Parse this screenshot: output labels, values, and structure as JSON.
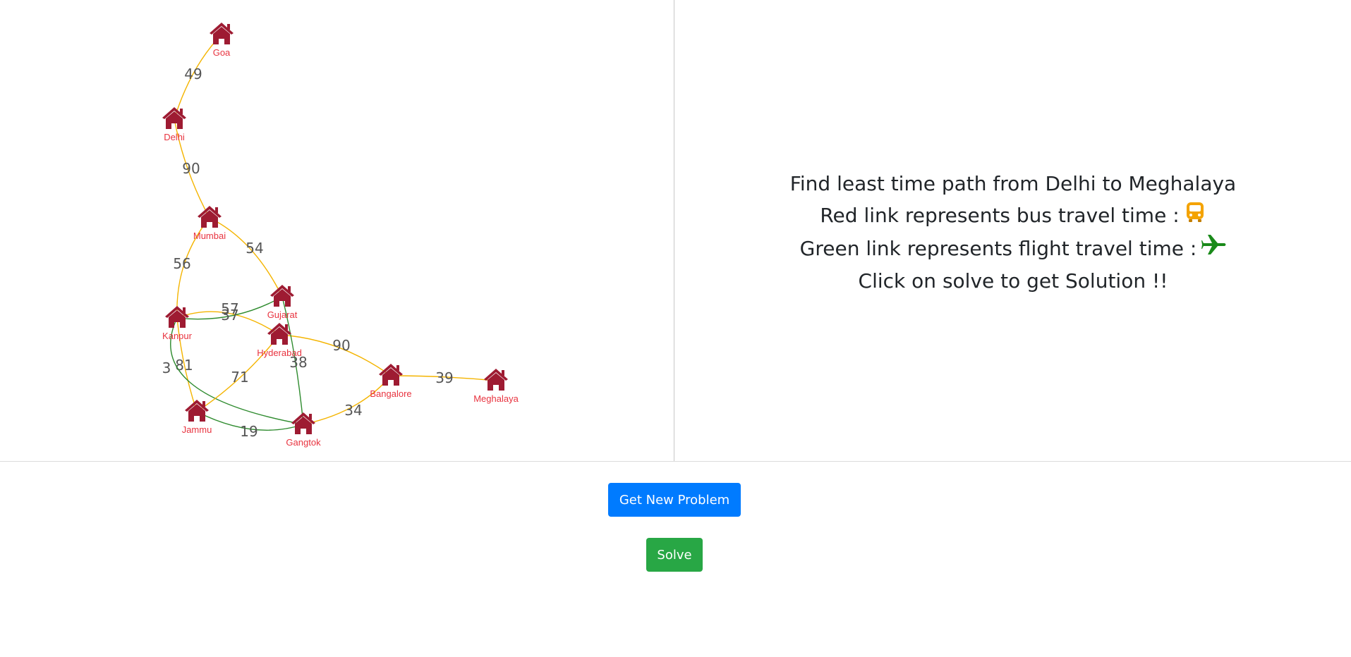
{
  "graph": {
    "colors": {
      "bus": "#f4b400",
      "flight": "#2e8b2e",
      "node": "#9e1b32",
      "label": "#e8333f"
    },
    "nodes": [
      {
        "id": "goa",
        "label": "Goa"
      },
      {
        "id": "delhi",
        "label": "Delhi"
      },
      {
        "id": "mumbai",
        "label": "Mumbai"
      },
      {
        "id": "gujarat",
        "label": "Gujarat"
      },
      {
        "id": "kanpur",
        "label": "Kanpur"
      },
      {
        "id": "hyderabad",
        "label": "Hyderabad"
      },
      {
        "id": "bangalore",
        "label": "Bangalore"
      },
      {
        "id": "meghalaya",
        "label": "Meghalaya"
      },
      {
        "id": "jammu",
        "label": "Jammu"
      },
      {
        "id": "gangtok",
        "label": "Gangtok"
      }
    ],
    "edges": [
      {
        "from": "goa",
        "to": "delhi",
        "weight": "49",
        "mode": "bus"
      },
      {
        "from": "delhi",
        "to": "mumbai",
        "weight": "90",
        "mode": "bus"
      },
      {
        "from": "mumbai",
        "to": "gujarat",
        "weight": "54",
        "mode": "bus"
      },
      {
        "from": "mumbai",
        "to": "kanpur",
        "weight": "56",
        "mode": "bus"
      },
      {
        "from": "kanpur",
        "to": "hyderabad",
        "weight": "57",
        "mode": "bus"
      },
      {
        "from": "kanpur",
        "to": "gujarat",
        "weight": "37",
        "mode": "flight"
      },
      {
        "from": "kanpur",
        "to": "jammu",
        "weight": "81",
        "mode": "bus"
      },
      {
        "from": "kanpur",
        "to": "gangtok",
        "weight": "3",
        "mode": "flight"
      },
      {
        "from": "hyderabad",
        "to": "jammu",
        "weight": "71",
        "mode": "bus"
      },
      {
        "from": "hyderabad",
        "to": "bangalore",
        "weight": "90",
        "mode": "bus"
      },
      {
        "from": "gujarat",
        "to": "gangtok",
        "weight": "38",
        "mode": "flight"
      },
      {
        "from": "jammu",
        "to": "gangtok",
        "weight": "19",
        "mode": "flight"
      },
      {
        "from": "gangtok",
        "to": "bangalore",
        "weight": "34",
        "mode": "bus"
      },
      {
        "from": "bangalore",
        "to": "meghalaya",
        "weight": "39",
        "mode": "bus"
      }
    ]
  },
  "instructions": {
    "line1": "Find least time path from Delhi to Meghalaya",
    "line2": "Red link represents bus travel time :",
    "line3": "Green link represents flight travel time :",
    "line4": "Click on solve to get Solution !!",
    "bus_icon": "bus-icon",
    "flight_icon": "airplane-icon",
    "bus_icon_color": "#f4a300",
    "flight_icon_color": "#1a8a1a"
  },
  "buttons": {
    "new_problem": "Get New Problem",
    "solve": "Solve"
  }
}
